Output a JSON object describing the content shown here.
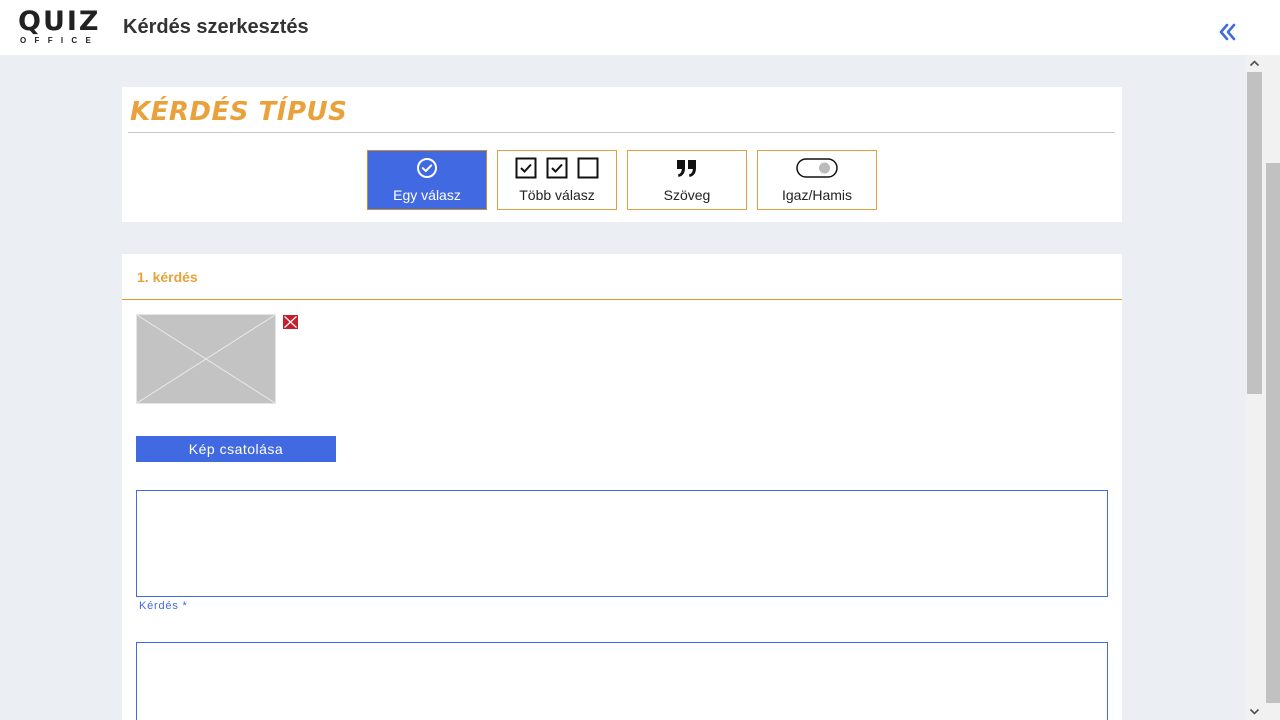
{
  "header": {
    "logo_main": "QUIZ",
    "logo_sub": "OFFICE",
    "title": "Kérdés szerkesztés"
  },
  "question_type": {
    "heading": "KÉRDÉS TÍPUS",
    "options": [
      {
        "label": "Egy válasz",
        "icon": "check-circle-icon",
        "selected": true
      },
      {
        "label": "Több válasz",
        "icon": "checkboxes-icon",
        "selected": false
      },
      {
        "label": "Szöveg",
        "icon": "quote-icon",
        "selected": false
      },
      {
        "label": "Igaz/Hamis",
        "icon": "toggle-icon",
        "selected": false
      }
    ]
  },
  "question": {
    "title": "1. kérdés",
    "attach_label": "Kép csatolása",
    "question_label": "Kérdés *"
  },
  "colors": {
    "accent": "#4169e1",
    "brand_orange": "#e9a23b"
  }
}
